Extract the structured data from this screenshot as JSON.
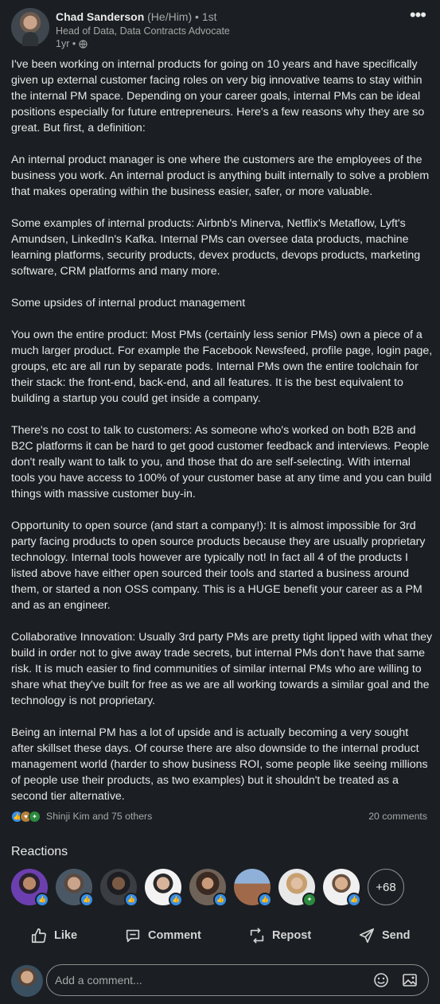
{
  "author": {
    "name": "Chad Sanderson",
    "pronouns": "(He/Him)",
    "degree": "• 1st",
    "headline": "Head of Data, Data Contracts Advocate",
    "time": "1yr •"
  },
  "post": {
    "paragraphs": [
      "I've been working on internal products for going on 10 years and have specifically given up external customer facing roles on very big innovative teams to stay within the internal PM space. Depending on your career goals, internal PMs can be ideal positions especially for future entrepreneurs. Here's a few reasons why they are so great. But first, a definition:",
      "An internal product manager is one where the customers are the employees of the business you work. An internal product is anything built internally to solve a problem that makes operating within the business easier, safer, or more valuable.",
      "Some examples of internal products: Airbnb's Minerva, Netflix's Metaflow, Lyft's Amundsen, LinkedIn's Kafka. Internal PMs can oversee data products, machine learning platforms, security products, devex products, devops products, marketing software, CRM platforms and many more.",
      "Some upsides of internal product management",
      "You own the entire product: Most PMs (certainly less senior PMs) own a piece of a much larger product. For example the Facebook Newsfeed, profile page, login page, groups, etc are all run by separate pods. Internal PMs own the entire toolchain for their stack: the front-end, back-end, and all features. It is the best equivalent to building a startup you could get inside a company.",
      "There's no cost to talk to customers: As someone who's worked on both B2B and B2C platforms it can be hard to get good customer feedback and interviews. People don't really want to talk to you, and those that do are self-selecting. With internal tools you have access to 100% of your customer base at any time and you can build things with massive customer buy-in.",
      "Opportunity to open source (and start a company!): It is almost impossible for 3rd party facing products to open source products because they are usually proprietary technology. Internal tools however are typically not! In fact all 4 of the products I listed above have either open sourced their tools and started a business around them, or started a non OSS company. This is a HUGE benefit your career as a PM and as an engineer.",
      "Collaborative Innovation: Usually 3rd party PMs are pretty tight lipped with what they build in order not to give away trade secrets, but internal PMs don't have that same risk. It is much easier to find communities of similar internal PMs who are willing to share what they've built for free as we are all working towards a similar goal and the technology is not proprietary.",
      "Being an internal PM has a lot of upside and is actually becoming a very sought after skillset these days. Of course there are also downside to the internal product management world (harder to show business ROI, some people like seeing millions of people use their products, as two examples) but it shouldn't be treated as a second tier alternative."
    ]
  },
  "social": {
    "reactors_text": "Shinji Kim and 75 others",
    "comments_text": "20 comments"
  },
  "reactions": {
    "title": "Reactions",
    "more_label": "+68"
  },
  "actions": {
    "like": "Like",
    "comment": "Comment",
    "repost": "Repost",
    "send": "Send"
  },
  "comment_box": {
    "placeholder": "Add a comment..."
  },
  "colors": {
    "background": "#1b1f23",
    "like_blue": "#378fe9",
    "muted_text": "#a7a7a7"
  }
}
